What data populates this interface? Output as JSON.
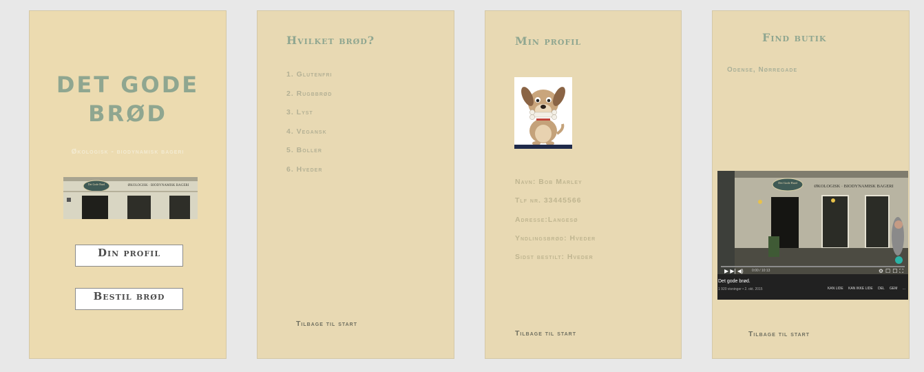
{
  "home": {
    "title_line1": "DET GODE",
    "title_line2": "BRØD",
    "tagline": "Økologisk - biodynamisk bageri",
    "profile_button": "Din profil",
    "order_button": "Bestil brød"
  },
  "order": {
    "heading": "Hvilket brød?",
    "items": [
      "1. Glutenfri",
      "2. Rugbbrød",
      "3. Lyst",
      "4. Vegansk",
      "5. Boller",
      "6. Hveder"
    ],
    "back": "Tilbage til start"
  },
  "profile": {
    "heading": "Min profil",
    "name": "Navn: Bob Marley",
    "phone": "Tlf nr. 33445566",
    "address": "Adresse:Langesø",
    "favorite": "Yndlingsbrød: Hveder",
    "last_order": "Sidst bestilt: Hveder",
    "back": "Tilbage til start"
  },
  "store": {
    "heading": "Find butik",
    "location": "Odense, Nørregade",
    "video_title": "Det gode brød.",
    "video_sub": "1 920 visninger • 2. okt. 2015",
    "video_time": "0:00 / 10:13",
    "video_actions": [
      "KAN LIDE",
      "KAN IKKE LIDE",
      "DEL",
      "GEM",
      "..."
    ],
    "back": "Tilbage til start"
  },
  "sign_text": "ØKOLOGISK · BIODYNAMISK BAGERI",
  "logo_text": "Det Gode Brød",
  "colors": {
    "background": "#e8e8e8",
    "card": "#e8d9b3",
    "accent_green": "#8fa690",
    "button_text": "#4d4d4d"
  }
}
